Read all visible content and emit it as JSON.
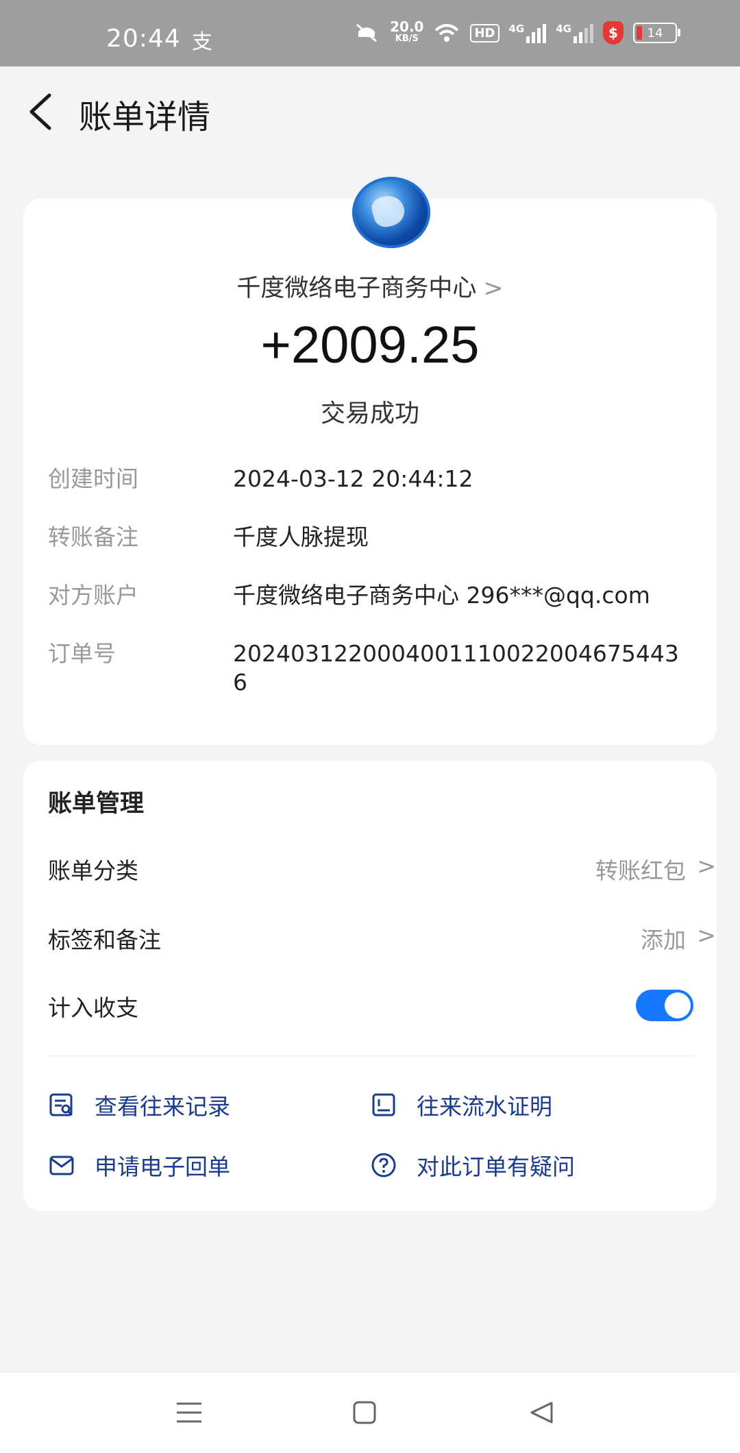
{
  "status_bar": {
    "time": "20:44",
    "app_icon": "支",
    "net_speed": "20.0",
    "net_unit": "KB/S",
    "hd": "HD",
    "sig1": "4G",
    "sig2": "4G",
    "shield": "$",
    "battery": "14"
  },
  "header": {
    "title": "账单详情"
  },
  "detail": {
    "merchant": "千度微络电子商务中心",
    "amount": "+2009.25",
    "status": "交易成功",
    "rows": [
      {
        "label": "创建时间",
        "value": "2024-03-12 20:44:12"
      },
      {
        "label": "转账备注",
        "value": "千度人脉提现"
      },
      {
        "label": "对方账户",
        "value": "千度微络电子商务中心 296***@qq.com"
      },
      {
        "label": "订单号",
        "value": "20240312200040011100220046754436"
      }
    ]
  },
  "management": {
    "title": "账单管理",
    "category_label": "账单分类",
    "category_value": "转账红包",
    "tags_label": "标签和备注",
    "tags_value": "添加",
    "income_label": "计入收支",
    "income_enabled": true,
    "actions": {
      "records": "查看往来记录",
      "statement": "往来流水证明",
      "receipt": "申请电子回单",
      "question": "对此订单有疑问"
    }
  },
  "colors": {
    "accent": "#1677ff",
    "link": "#1b3b8c",
    "status_bar": "#9e9e9e"
  }
}
